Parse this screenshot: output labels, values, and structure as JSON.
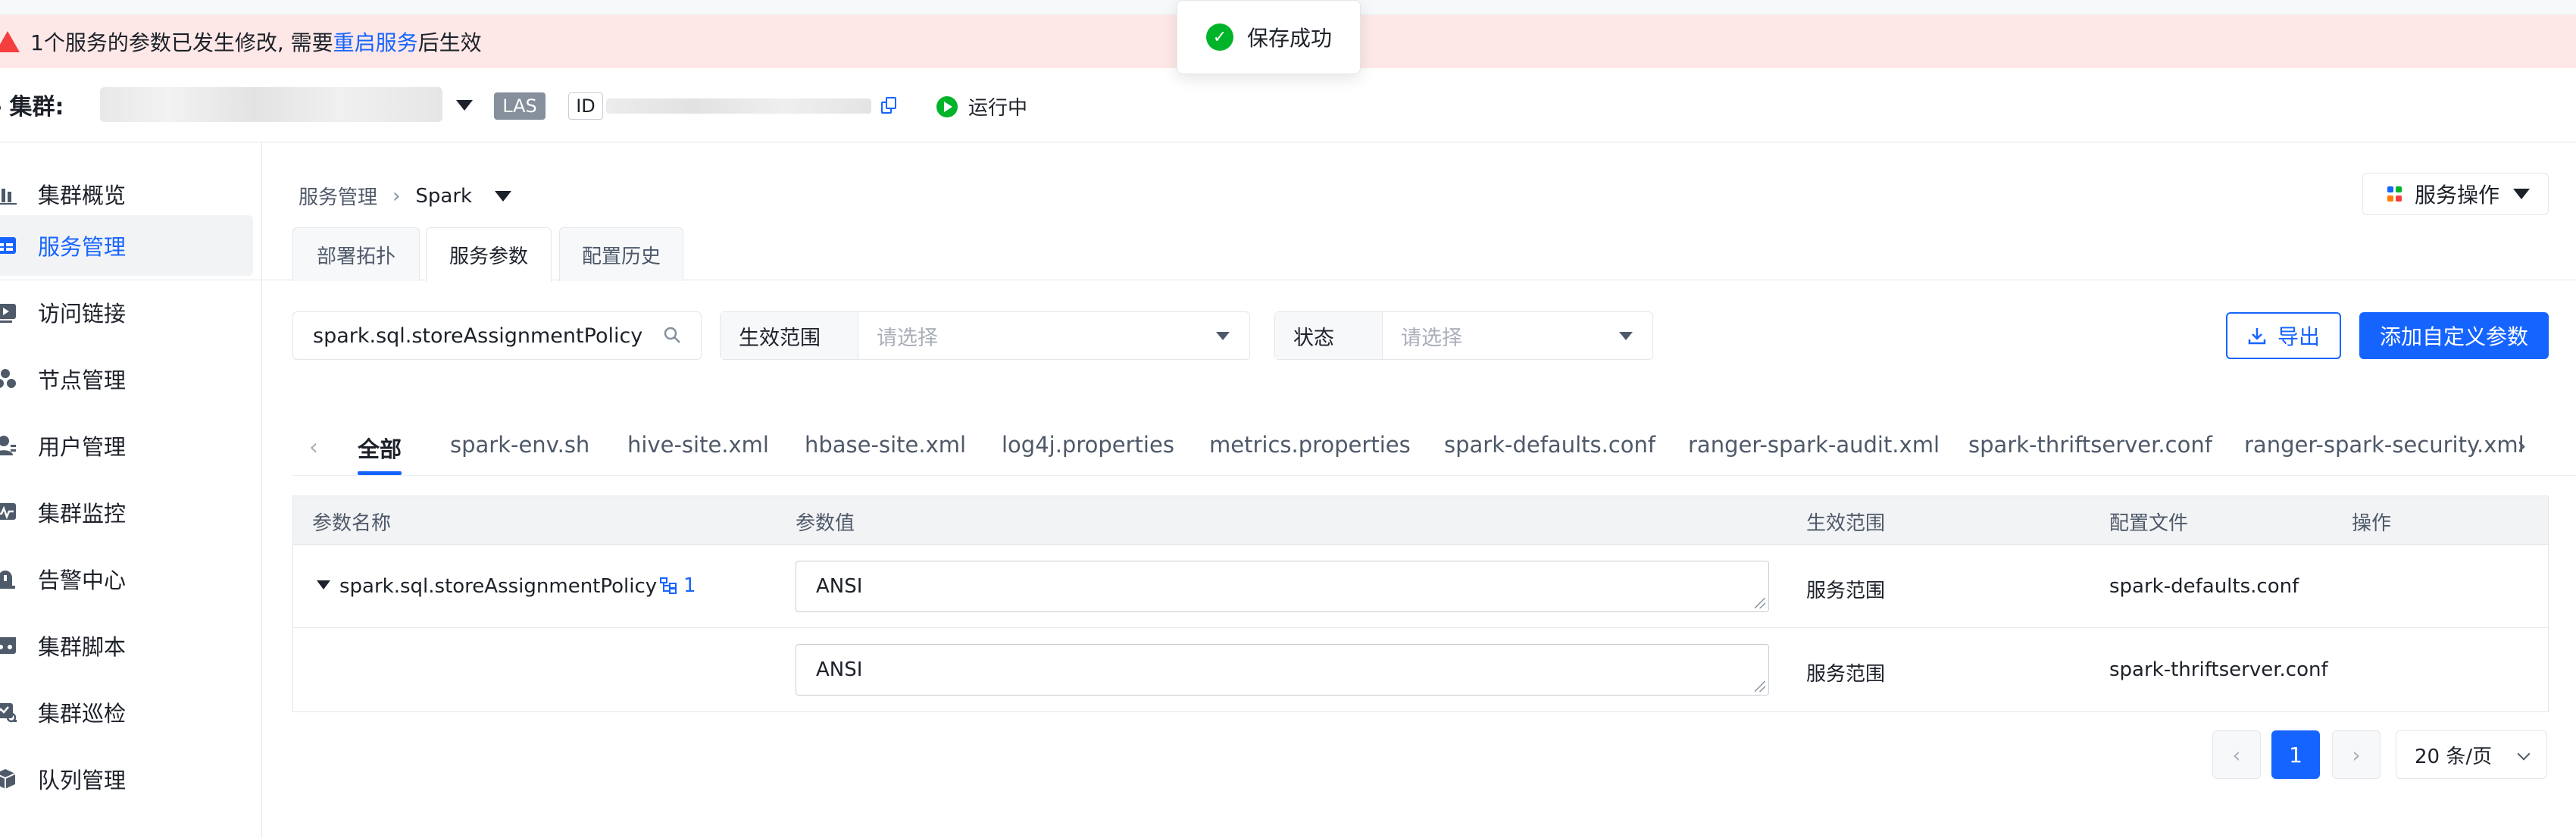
{
  "banner": {
    "prefix": "1个服务的参数已发生修改, 需要",
    "link": "重启服务",
    "suffix": "后生效"
  },
  "toast": {
    "message": "保存成功"
  },
  "cluster": {
    "label": "集群:",
    "type_tag": "LAS",
    "id_tag": "ID",
    "status": "运行中"
  },
  "sidebar": {
    "items": [
      {
        "label": "集群概览",
        "icon": "bar-chart-icon"
      },
      {
        "label": "服务管理",
        "icon": "service-grid-icon",
        "active": true
      },
      {
        "label": "访问链接",
        "icon": "link-play-icon"
      },
      {
        "label": "节点管理",
        "icon": "nodes-icon"
      },
      {
        "label": "用户管理",
        "icon": "user-icon"
      },
      {
        "label": "集群监控",
        "icon": "monitor-icon"
      },
      {
        "label": "告警中心",
        "icon": "alarm-icon"
      },
      {
        "label": "集群脚本",
        "icon": "script-icon"
      },
      {
        "label": "集群巡检",
        "icon": "inspect-icon"
      },
      {
        "label": "队列管理",
        "icon": "cube-icon"
      }
    ]
  },
  "breadcrumb": {
    "root": "服务管理",
    "current": "Spark"
  },
  "service_ops": {
    "label": "服务操作"
  },
  "top_tabs": [
    {
      "label": "部署拓扑"
    },
    {
      "label": "服务参数",
      "active": true
    },
    {
      "label": "配置历史"
    }
  ],
  "filters": {
    "search_value": "spark.sql.storeAssignmentPolicy",
    "scope_label": "生效范围",
    "scope_placeholder": "请选择",
    "status_label": "状态",
    "status_placeholder": "请选择"
  },
  "actions": {
    "export": "导出",
    "add_custom": "添加自定义参数"
  },
  "file_tabs": [
    "全部",
    "spark-env.sh",
    "hive-site.xml",
    "hbase-site.xml",
    "log4j.properties",
    "metrics.properties",
    "spark-defaults.conf",
    "ranger-spark-audit.xml",
    "spark-thriftserver.conf",
    "ranger-spark-security.xml"
  ],
  "table": {
    "headers": [
      "参数名称",
      "参数值",
      "生效范围",
      "配置文件",
      "操作"
    ],
    "rows": [
      {
        "name": "spark.sql.storeAssignmentPolicy",
        "ref_count": "1",
        "value": "ANSI",
        "scope": "服务范围",
        "file": "spark-defaults.conf"
      },
      {
        "name": "",
        "value": "ANSI",
        "scope": "服务范围",
        "file": "spark-thriftserver.conf"
      }
    ]
  },
  "pagination": {
    "current": "1",
    "page_size": "20 条/页"
  },
  "colors": {
    "primary": "#1664ff",
    "success": "#00b42a",
    "danger": "#f53f3f",
    "banner_bg": "#fde8e7"
  }
}
